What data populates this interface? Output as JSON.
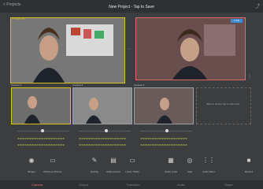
{
  "header": {
    "back_label": "< Projects",
    "title": "New Project - Tap to Save",
    "share_icon": "share-icon"
  },
  "preview": {
    "label": "PREVIEW"
  },
  "program": {
    "badge": "LIVE"
  },
  "cameras": [
    {
      "label": "Camera 1"
    },
    {
      "label": "Camera 2"
    },
    {
      "label": "Camera 3"
    }
  ],
  "empty_slot": {
    "text": "Wait for device\nTap to add more"
  },
  "tabs": [
    "Camera",
    "Output",
    "Transition",
    "Audio",
    "Share"
  ],
  "tools": [
    {
      "label": "Stinger"
    },
    {
      "label": "Picture-in-Picture"
    },
    {
      "label": "Overlay"
    },
    {
      "label": "Multi-camera"
    },
    {
      "label": "Lower Thirds"
    },
    {
      "label": "Stream"
    }
  ],
  "tools_right": [
    {
      "label": "Guide Lines"
    },
    {
      "label": "Auto"
    },
    {
      "label": "Audio Mixer"
    },
    {
      "label": "Record"
    }
  ]
}
